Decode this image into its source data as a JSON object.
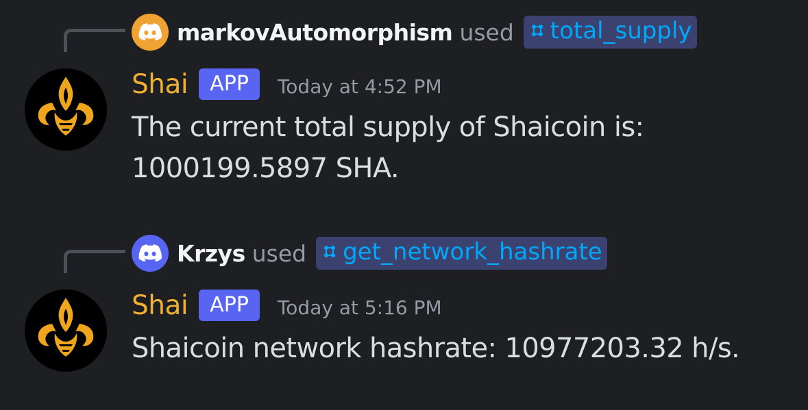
{
  "messages": [
    {
      "reply": {
        "username": "markovAutomorphism",
        "used_text": "used",
        "command": "total_supply",
        "avatar_color": "#f0a232",
        "avatar_icon": "discord-logo-icon"
      },
      "author": {
        "name": "Shai",
        "name_color": "#f0b132",
        "badge": "APP",
        "avatar_icon": "shai-logo-icon"
      },
      "timestamp": "Today at 4:52 PM",
      "content_lines": [
        "The current total supply of Shaicoin is:",
        "1000199.5897 SHA."
      ]
    },
    {
      "reply": {
        "username": "Krzys",
        "used_text": "used",
        "command": "get_network_hashrate",
        "avatar_color": "#5865f2",
        "avatar_icon": "discord-logo-icon"
      },
      "author": {
        "name": "Shai",
        "name_color": "#f0b132",
        "badge": "APP",
        "avatar_icon": "shai-logo-icon"
      },
      "timestamp": "Today at 5:16 PM",
      "content_lines": [
        "Shaicoin network hashrate: 10977203.32 h/s."
      ]
    }
  ],
  "colors": {
    "background": "#1e1f22",
    "command_text": "#00a8fc",
    "command_bg": "#3c4270",
    "app_badge": "#5865f2"
  }
}
